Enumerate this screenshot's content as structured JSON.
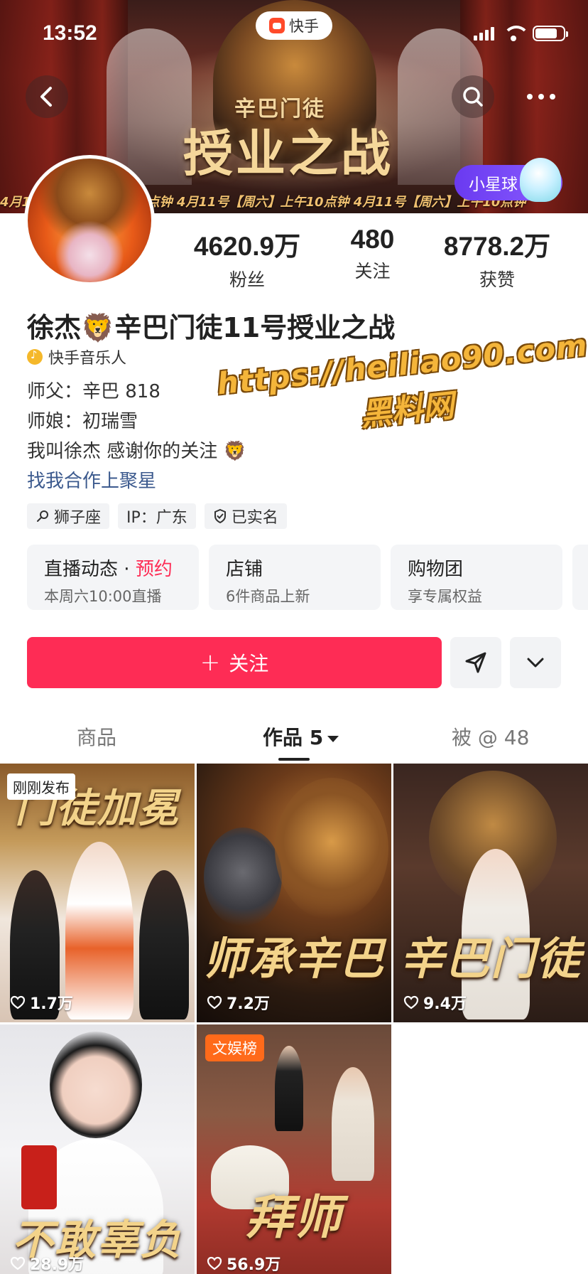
{
  "status_bar": {
    "time": "13:52",
    "app_name": "快手"
  },
  "banner": {
    "title_small": "辛巴门徒",
    "title_big": "授业之战",
    "ticker": "4月11号【周六】上午10点钟    4月11号【周六】上午10点钟    4月11号【周六】上午10点钟",
    "planet_badge": "小星球"
  },
  "profile": {
    "stats": [
      {
        "value": "4620.9万",
        "label": "粉丝"
      },
      {
        "value": "480",
        "label": "关注"
      },
      {
        "value": "8778.2万",
        "label": "获赞"
      }
    ],
    "name": "徐杰🦁辛巴门徒11号授业之战",
    "certification": "快手音乐人",
    "bio": [
      "师父：辛巴 818",
      "师娘：初瑞雪",
      "我叫徐杰 感谢你的关注 🦁"
    ],
    "cooperate_link": "找我合作上聚星",
    "tags": [
      "狮子座",
      "IP：广东",
      "已实名"
    ]
  },
  "watermark": {
    "url": "https://heiliao90.com",
    "site": "黑料网"
  },
  "cards": [
    {
      "title": "直播动态",
      "highlight": "预约",
      "sub": "本周六10:00直播"
    },
    {
      "title": "店铺",
      "highlight": "",
      "sub": "6件商品上新"
    },
    {
      "title": "购物团",
      "highlight": "",
      "sub": "享专属权益"
    }
  ],
  "actions": {
    "follow": "关注"
  },
  "tabs": [
    {
      "label": "商品"
    },
    {
      "label": "作品 5"
    },
    {
      "label": "被 @ 48"
    }
  ],
  "videos": [
    {
      "caption": "门徒加冕",
      "likes": "1.7万",
      "badge": "刚刚发布"
    },
    {
      "caption": "师承辛巴",
      "likes": "7.2万",
      "badge": ""
    },
    {
      "caption": "辛巴门徒",
      "likes": "9.4万",
      "badge": ""
    },
    {
      "caption": "不敢辜负",
      "likes": "28.9万",
      "badge": ""
    },
    {
      "caption": "拜师",
      "likes": "56.9万",
      "badge": "文娱榜"
    }
  ],
  "colors": {
    "accent": "#fe2c55",
    "link": "#3c5a8e",
    "planet": "#7a4af8"
  }
}
